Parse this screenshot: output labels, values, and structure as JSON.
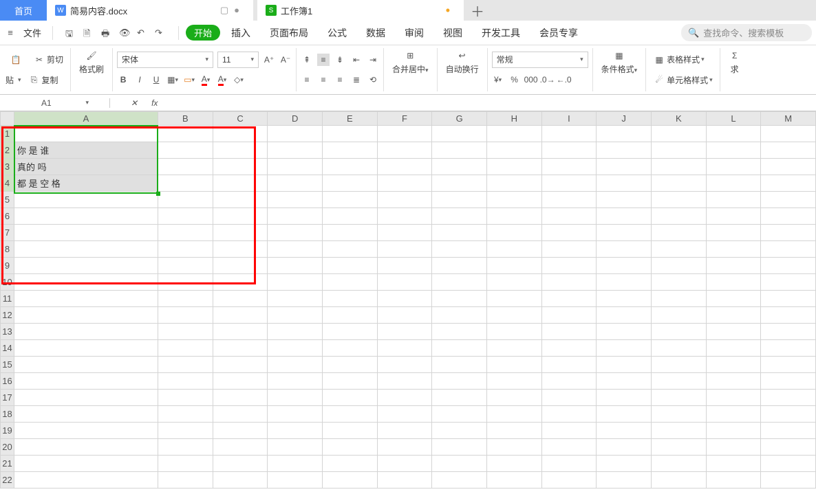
{
  "tabs": {
    "home": "首页",
    "docx": "简易内容.docx",
    "sheet": "工作簿1",
    "doc_icon": "W",
    "sheet_icon": "S"
  },
  "menu": {
    "file": "文件",
    "start": "开始",
    "insert": "插入",
    "layout": "页面布局",
    "formula": "公式",
    "data": "数据",
    "review": "审阅",
    "view": "视图",
    "dev": "开发工具",
    "vip": "会员专享",
    "search_ph": "查找命令、搜索模板"
  },
  "ribbon": {
    "paste": "贴",
    "cut": "剪切",
    "copy": "复制",
    "brush": "格式刷",
    "font": "宋体",
    "size": "11",
    "merge": "合并居中",
    "wrap": "自动换行",
    "numfmt": "常规",
    "cond": "条件格式",
    "tablestyle": "表格样式",
    "cellstyle": "单元格样式",
    "sigma": "求"
  },
  "fbar": {
    "name": "A1",
    "fx": "fx"
  },
  "cols": [
    "A",
    "B",
    "C",
    "D",
    "E",
    "F",
    "G",
    "H",
    "I",
    "J",
    "K",
    "L",
    "M"
  ],
  "rows": [
    "1",
    "2",
    "3",
    "4",
    "5",
    "6",
    "7",
    "8",
    "9",
    "10",
    "11",
    "12",
    "13",
    "14",
    "15",
    "16",
    "17",
    "18",
    "19",
    "20",
    "21",
    "22"
  ],
  "cells": {
    "A2": "你 是 谁",
    "A3": "真的 吗",
    "A4": "都 是 空 格"
  }
}
